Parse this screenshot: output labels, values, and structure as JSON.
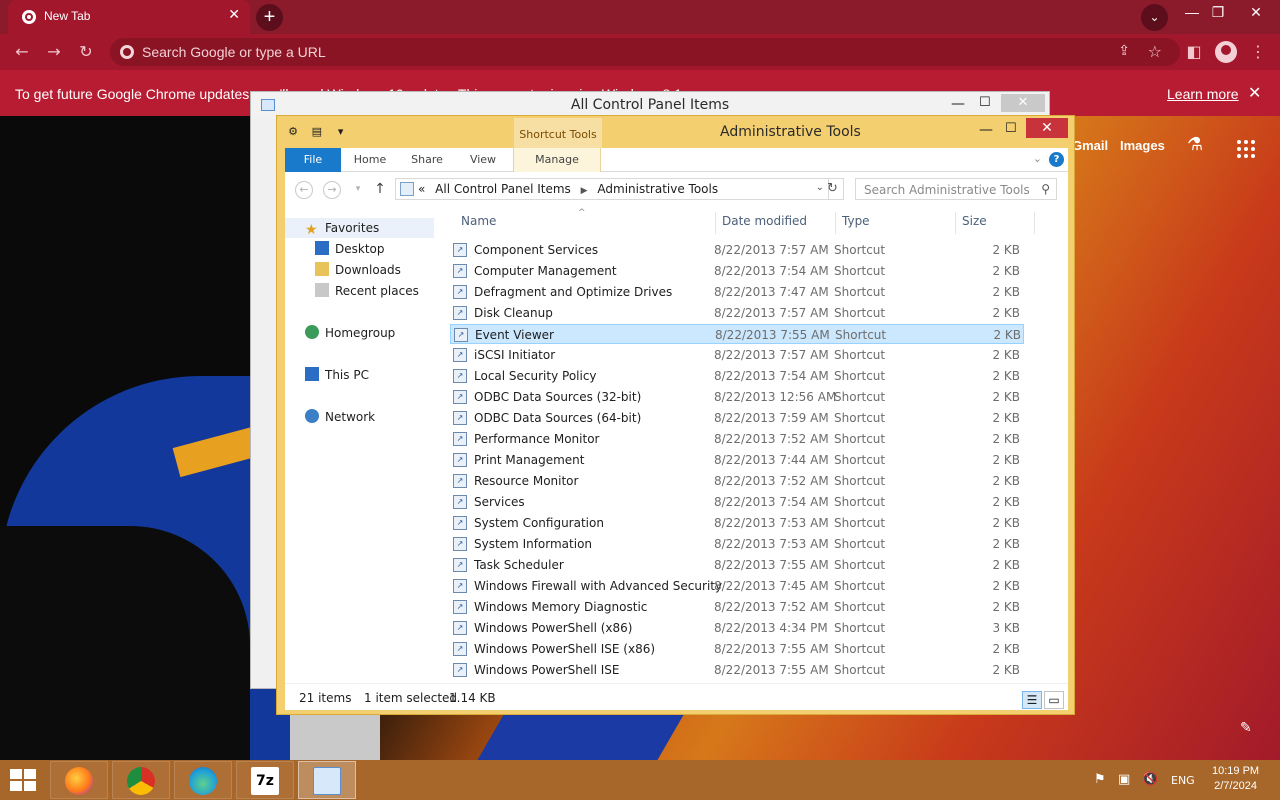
{
  "chrome": {
    "tab_title": "New Tab",
    "tab_close": "✕",
    "new_tab": "+",
    "omnibox_placeholder": "Search Google or type a URL",
    "infobar_text": "To get future Google Chrome updates, you'll need Windows 10 or later. This computer is using Windows 8.1.",
    "learn_more": "Learn more",
    "infobar_close": "✕",
    "win_minimize": "—",
    "win_maximize": "❐",
    "win_close": "✕"
  },
  "ntp": {
    "gmail": "Gmail",
    "images": "Images"
  },
  "back_window": {
    "title": "All Control Panel Items",
    "minimize": "—",
    "maximize": "☐",
    "close": "✕"
  },
  "window": {
    "title": "Administrative Tools",
    "context_tab_group": "Shortcut Tools",
    "minimize": "—",
    "maximize": "☐",
    "close": "✕",
    "ribbon_tabs": [
      "File",
      "Home",
      "Share",
      "View",
      "Manage"
    ],
    "help": "?",
    "breadcrumb": [
      "All Control Panel Items",
      "Administrative Tools"
    ],
    "breadcrumb_prefix": "«",
    "search_placeholder": "Search Administrative Tools",
    "nav": {
      "favorites": "Favorites",
      "desktop": "Desktop",
      "downloads": "Downloads",
      "recent_places": "Recent places",
      "homegroup": "Homegroup",
      "this_pc": "This PC",
      "network": "Network"
    },
    "columns": {
      "name": "Name",
      "date": "Date modified",
      "type": "Type",
      "size": "Size"
    },
    "files": [
      {
        "name": "Component Services",
        "date": "8/22/2013 7:57 AM",
        "type": "Shortcut",
        "size": "2 KB"
      },
      {
        "name": "Computer Management",
        "date": "8/22/2013 7:54 AM",
        "type": "Shortcut",
        "size": "2 KB"
      },
      {
        "name": "Defragment and Optimize Drives",
        "date": "8/22/2013 7:47 AM",
        "type": "Shortcut",
        "size": "2 KB"
      },
      {
        "name": "Disk Cleanup",
        "date": "8/22/2013 7:57 AM",
        "type": "Shortcut",
        "size": "2 KB"
      },
      {
        "name": "Event Viewer",
        "date": "8/22/2013 7:55 AM",
        "type": "Shortcut",
        "size": "2 KB"
      },
      {
        "name": "iSCSI Initiator",
        "date": "8/22/2013 7:57 AM",
        "type": "Shortcut",
        "size": "2 KB"
      },
      {
        "name": "Local Security Policy",
        "date": "8/22/2013 7:54 AM",
        "type": "Shortcut",
        "size": "2 KB"
      },
      {
        "name": "ODBC Data Sources (32-bit)",
        "date": "8/22/2013 12:56 AM",
        "type": "Shortcut",
        "size": "2 KB"
      },
      {
        "name": "ODBC Data Sources (64-bit)",
        "date": "8/22/2013 7:59 AM",
        "type": "Shortcut",
        "size": "2 KB"
      },
      {
        "name": "Performance Monitor",
        "date": "8/22/2013 7:52 AM",
        "type": "Shortcut",
        "size": "2 KB"
      },
      {
        "name": "Print Management",
        "date": "8/22/2013 7:44 AM",
        "type": "Shortcut",
        "size": "2 KB"
      },
      {
        "name": "Resource Monitor",
        "date": "8/22/2013 7:52 AM",
        "type": "Shortcut",
        "size": "2 KB"
      },
      {
        "name": "Services",
        "date": "8/22/2013 7:54 AM",
        "type": "Shortcut",
        "size": "2 KB"
      },
      {
        "name": "System Configuration",
        "date": "8/22/2013 7:53 AM",
        "type": "Shortcut",
        "size": "2 KB"
      },
      {
        "name": "System Information",
        "date": "8/22/2013 7:53 AM",
        "type": "Shortcut",
        "size": "2 KB"
      },
      {
        "name": "Task Scheduler",
        "date": "8/22/2013 7:55 AM",
        "type": "Shortcut",
        "size": "2 KB"
      },
      {
        "name": "Windows Firewall with Advanced Security",
        "date": "8/22/2013 7:45 AM",
        "type": "Shortcut",
        "size": "2 KB"
      },
      {
        "name": "Windows Memory Diagnostic",
        "date": "8/22/2013 7:52 AM",
        "type": "Shortcut",
        "size": "2 KB"
      },
      {
        "name": "Windows PowerShell (x86)",
        "date": "8/22/2013 4:34 PM",
        "type": "Shortcut",
        "size": "3 KB"
      },
      {
        "name": "Windows PowerShell ISE (x86)",
        "date": "8/22/2013 7:55 AM",
        "type": "Shortcut",
        "size": "2 KB"
      },
      {
        "name": "Windows PowerShell ISE",
        "date": "8/22/2013 7:55 AM",
        "type": "Shortcut",
        "size": "2 KB"
      }
    ],
    "selected_file": "Event Viewer",
    "status": {
      "items": "21 items",
      "selected": "1 item selected",
      "size": "1.14 KB"
    }
  },
  "taskbar": {
    "language": "ENG",
    "time": "10:19 PM",
    "date": "2/7/2024"
  },
  "colors": {
    "chrome_tab": "#a3172d",
    "explorer_frame": "#f3cf70",
    "selection": "#cce8ff",
    "file_tab": "#1979ca"
  }
}
